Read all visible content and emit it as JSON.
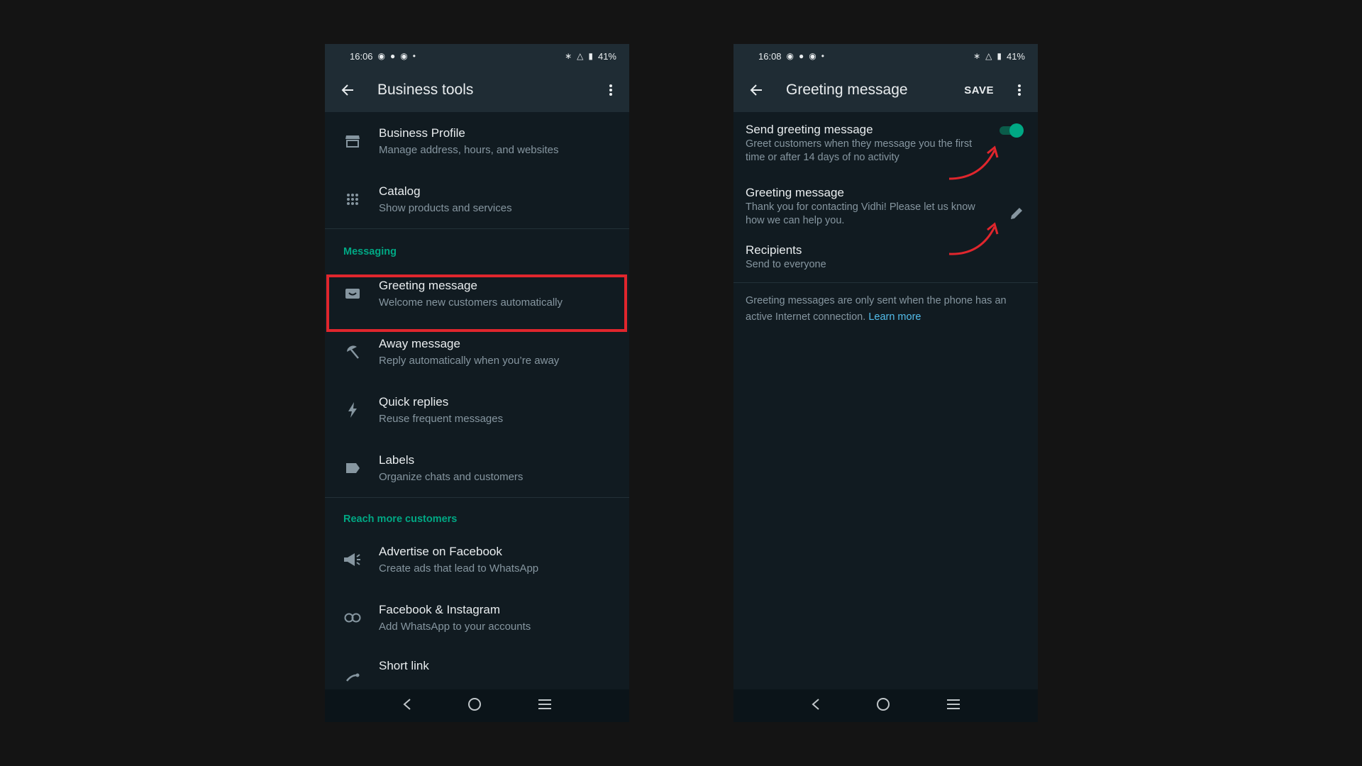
{
  "left": {
    "status": {
      "time": "16:06",
      "battery": "41%"
    },
    "title": "Business tools",
    "items_top": [
      {
        "icon": "store-icon",
        "primary": "Business Profile",
        "secondary": "Manage address, hours, and websites"
      },
      {
        "icon": "grid-icon",
        "primary": "Catalog",
        "secondary": "Show products and services"
      }
    ],
    "section_messaging": "Messaging",
    "items_messaging": [
      {
        "icon": "greeting-icon",
        "primary": "Greeting message",
        "secondary": "Welcome new customers automatically"
      },
      {
        "icon": "umbrella-icon",
        "primary": "Away message",
        "secondary": "Reply automatically when you’re away"
      },
      {
        "icon": "bolt-icon",
        "primary": "Quick replies",
        "secondary": "Reuse frequent messages"
      },
      {
        "icon": "label-icon",
        "primary": "Labels",
        "secondary": "Organize chats and customers"
      }
    ],
    "section_reach": "Reach more customers",
    "items_reach": [
      {
        "icon": "megaphone-icon",
        "primary": "Advertise on Facebook",
        "secondary": "Create ads that lead to WhatsApp"
      },
      {
        "icon": "link-icon",
        "primary": "Facebook & Instagram",
        "secondary": "Add WhatsApp to your accounts"
      },
      {
        "icon": "share-icon",
        "primary": "Short link",
        "secondary": ""
      }
    ]
  },
  "right": {
    "status": {
      "time": "16:08",
      "battery": "41%"
    },
    "title": "Greeting message",
    "save_label": "SAVE",
    "send": {
      "primary": "Send greeting message",
      "secondary": "Greet customers when they message you the first time or after 14 days of no activity",
      "enabled": true
    },
    "greeting": {
      "primary": "Greeting message",
      "secondary": "Thank you for contacting Vidhi! Please let us know how we can help you."
    },
    "recipients": {
      "primary": "Recipients",
      "secondary": "Send to everyone"
    },
    "note": "Greeting messages are only sent when the phone has an active Internet connection.",
    "learn_more": "Learn more"
  },
  "colors": {
    "accent": "#00a884",
    "highlight": "#e0262d",
    "link": "#53bdeb",
    "background": "#111b21",
    "appbar": "#1f2c34"
  }
}
